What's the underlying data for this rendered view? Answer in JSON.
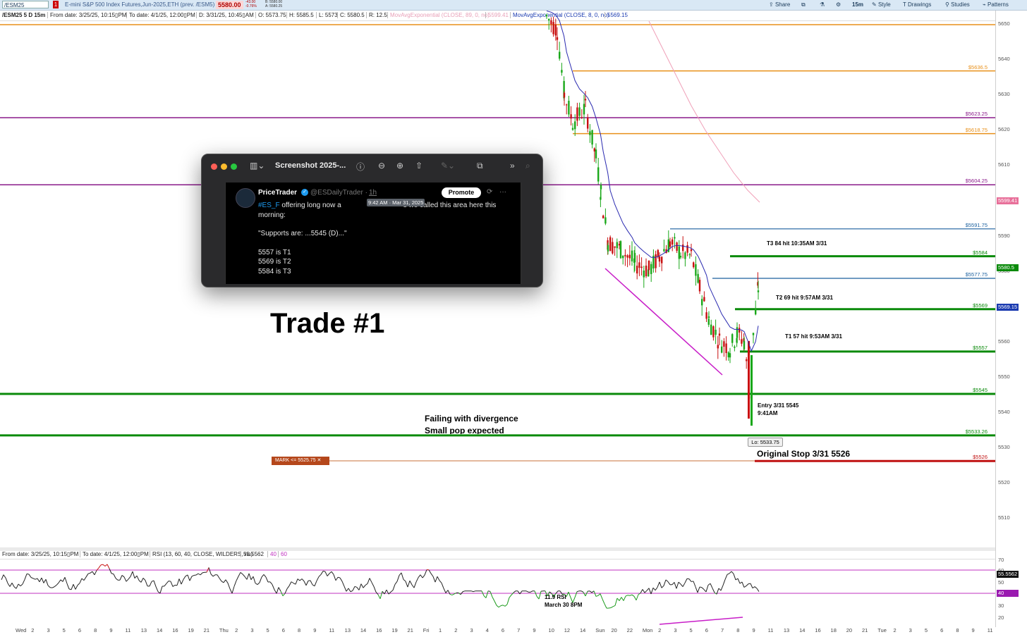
{
  "topbar": {
    "symbol": "/ESM25",
    "flag": "1",
    "description": "E-mini S&P 500 Index Futures,Jun-2025,ETH (prev. /ESM5)",
    "last_price": "5580.00",
    "change_net": "-43.00",
    "change_pct": "-0.76%",
    "bid": "B: 5580.00",
    "ask": "A: 5580.25",
    "tools": {
      "share": "Share",
      "timeframe": "15m",
      "style": "Style",
      "drawings": "Drawings",
      "studies": "Studies",
      "patterns": "Patterns"
    }
  },
  "infobar": {
    "chart_id": "/ESM25 5 D 15m",
    "from_date": "From date: 3/25/25, 10:15▯PM",
    "to_date": "To date: 4/1/25, 12:00▯PM",
    "d": "D: 3/31/25, 10:45▯AM",
    "open": "O: 5573.75",
    "high": "H: 5585.5",
    "low": "L: 5573",
    "close": "C: 5580.5",
    "range": "R: 12.5",
    "ma89": "MovAvgExponential (CLOSE, 89, 0, no)",
    "ma89_value": "5599.41",
    "ma8": "MovAvgExponential (CLOSE, 8, 0, no)",
    "ma8_value": "5569.15"
  },
  "rsi_infobar": {
    "from_date": "From date: 3/25/25, 10:15▯PM",
    "to_date": "To date: 4/1/25, 12:00▯PM",
    "study": "RSI (13, 60, 40, CLOSE, WILDERS, no)",
    "value": "55.5562",
    "lower": "40",
    "upper": "60"
  },
  "popup": {
    "title": "Screenshot 2025-...",
    "tweet": {
      "name": "PriceTrader",
      "handle": "@ESDailyTrader · ",
      "time": "1h",
      "promote": "Promote",
      "tooltip": "9:42 AM · Mar 31, 2025",
      "tag": "#ES_F",
      "line1": " offering long now a",
      "line1b": "s we called this area here this",
      "line2": "morning:",
      "quote": "\"Supports are: ...5545 (D)...\"",
      "t1": "5557 is T1",
      "t2": "5569 is T2",
      "t3": "5584 is T3"
    }
  },
  "annotations": {
    "trade_title": "Trade #1",
    "failing": "Failing with divergence",
    "small_pop": "Small pop expected",
    "t3_hit": "T3 84 hit 10:35AM 3/31",
    "t2_hit": "T2 69 hit 9:57AM 3/31",
    "t1_hit": "T1 57 hit 9:53AM 3/31",
    "entry_line1": "Entry 3/31 5545",
    "entry_line2": "9:41AM",
    "original_stop": "Original Stop 3/31 5526",
    "rsi_note1": "11.9 RSI",
    "rsi_note2": "March 30 8PM",
    "lo_label": "Lo: 5533.75",
    "mark_order": "MARK <= 5525.75 ✕"
  },
  "price_levels": [
    {
      "label": "$5636.5",
      "color": "#e8901a"
    },
    {
      "label": "$5623.25",
      "color": "#8a1a8a"
    },
    {
      "label": "$5618.75",
      "color": "#e8901a"
    },
    {
      "label": "$5604.25",
      "color": "#8a1a8a"
    },
    {
      "label": "$5591.75",
      "color": "#1a5f9e"
    },
    {
      "label": "$5584",
      "color": "#0a8a0a"
    },
    {
      "label": "$5577.75",
      "color": "#1a5f9e"
    },
    {
      "label": "$5569",
      "color": "#0a8a0a"
    },
    {
      "label": "$5557",
      "color": "#0a8a0a"
    },
    {
      "label": "$5545",
      "color": "#0a8a0a"
    },
    {
      "label": "$5533.26",
      "color": "#0a8a0a"
    },
    {
      "label": "$5526",
      "color": "#c01010"
    }
  ],
  "price_axis": [
    "5650",
    "5640",
    "5630",
    "5620",
    "5610",
    "5600",
    "5590",
    "5580",
    "5570",
    "5560",
    "5550",
    "5540",
    "5530",
    "5520",
    "5510"
  ],
  "price_tags": [
    {
      "label": "5599.41",
      "color": "#e8709a"
    },
    {
      "label": "5580.5",
      "color": "#0a8a0a"
    },
    {
      "label": "5569.15",
      "color": "#1a3ab0"
    }
  ],
  "rsi_axis": [
    "70",
    "60",
    "50",
    "40",
    "30",
    "20"
  ],
  "rsi_tags": [
    {
      "label": "55.5562",
      "color": "#111111"
    },
    {
      "label": "40",
      "color": "#9a1ab0"
    }
  ],
  "time_axis": [
    "Wed",
    "2",
    "3",
    "5",
    "6",
    "8",
    "9",
    "11",
    "13",
    "14",
    "16",
    "19",
    "21",
    "Thu",
    "2",
    "3",
    "5",
    "6",
    "8",
    "9",
    "11",
    "13",
    "14",
    "16",
    "19",
    "21",
    "Fri",
    "1",
    "2",
    "3",
    "4",
    "6",
    "7",
    "9",
    "10",
    "12",
    "14",
    "Sun",
    "20",
    "22",
    "Mon",
    "2",
    "3",
    "5",
    "6",
    "7",
    "8",
    "9",
    "11",
    "13",
    "14",
    "16",
    "18",
    "20",
    "21",
    "Tue",
    "2",
    "3",
    "5",
    "6",
    "8",
    "9",
    "11"
  ]
}
